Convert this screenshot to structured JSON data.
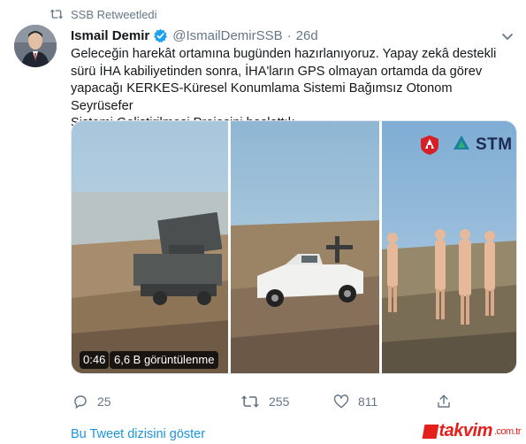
{
  "retweet": {
    "label": "SSB Retweetledi",
    "icon": "retweet-icon"
  },
  "author": {
    "name": "Ismail Demir",
    "handle": "@IsmailDemirSSB",
    "separator": "·",
    "time": "26d",
    "verified_color": "#1da1f2"
  },
  "tweet": {
    "lines": [
      "Geleceğin harekât ortamına bugünden hazırlanıyoruz. Yapay zekâ destekli",
      "sürü İHA kabiliyetinden sonra, İHA'ların GPS olmayan ortamda da görev",
      "yapacağı KERKES-Küresel Konumlama Sistemi Bağımsız Otonom Seyrüsefer",
      "Sistemi Geliştirilmesi Projesini başlattık."
    ]
  },
  "video": {
    "duration": "0:46",
    "views": "6,6 B görüntülenme",
    "brand_logo": "STM",
    "panels": [
      "launcher-scene",
      "pickup-truck-scene",
      "mannequins-scene"
    ]
  },
  "actions": {
    "reply": {
      "icon": "reply-icon",
      "count": "25"
    },
    "retweet": {
      "icon": "retweet-icon",
      "count": "255"
    },
    "like": {
      "icon": "heart-icon",
      "count": "811"
    },
    "share": {
      "icon": "share-icon"
    }
  },
  "show_thread": "Bu Tweet dizisini göster",
  "watermark": {
    "text": "takvim",
    "suffix": ".com.tr"
  },
  "colors": {
    "link": "#1b95e0",
    "muted": "#657786",
    "text": "#14171a",
    "watermark": "#e3201b"
  }
}
